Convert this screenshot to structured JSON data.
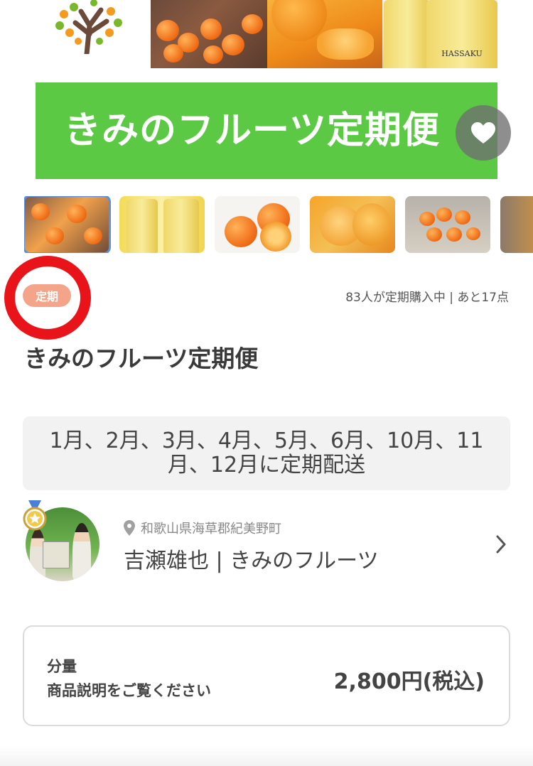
{
  "product": {
    "banner_text": "きみのフルーツ定期便",
    "badge": "定期",
    "stock_info": "83人が定期購入中 | あと17点",
    "title": "きみのフルーツ定期便",
    "schedule": "1月、2月、3月、4月、5月、6月、10月、11月、12月に定期配送"
  },
  "hero": {
    "bottle_label_1": "HASSAKU"
  },
  "thumbnails": [
    {
      "name": "thumb-1",
      "selected": true
    },
    {
      "name": "thumb-2",
      "selected": false
    },
    {
      "name": "thumb-3",
      "selected": false
    },
    {
      "name": "thumb-4",
      "selected": false
    },
    {
      "name": "thumb-5",
      "selected": false
    },
    {
      "name": "thumb-6",
      "selected": false
    }
  ],
  "seller": {
    "location": "和歌山県海草郡紀美野町",
    "name": "吉瀬雄也 | きみのフルーツ"
  },
  "price_card": {
    "quantity_label": "分量",
    "quantity_value": "商品説明をご覧ください",
    "price": "2,800円(税込)"
  },
  "colors": {
    "banner_green": "#5cc945",
    "badge_salmon": "#f4a589",
    "annotation_red": "#e8141a",
    "selected_thumb_blue": "#5b8fe0"
  },
  "icons": [
    "heart-icon",
    "location-pin-icon",
    "chevron-right-icon",
    "medal-icon"
  ]
}
